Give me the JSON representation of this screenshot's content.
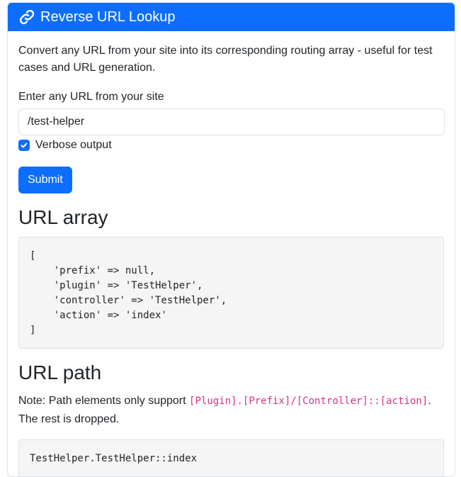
{
  "header": {
    "title": "Reverse URL Lookup",
    "icon": "link-icon"
  },
  "intro": "Convert any URL from your site into its corresponding routing array - useful for test cases and URL generation.",
  "form": {
    "url_label": "Enter any URL from your site",
    "url_value": "/test-helper",
    "verbose_label": "Verbose output",
    "verbose_checked": true,
    "submit_label": "Submit"
  },
  "url_array": {
    "heading": "URL array",
    "code": "[\n    'prefix' => null,\n    'plugin' => 'TestHelper',\n    'controller' => 'TestHelper',\n    'action' => 'index'\n]"
  },
  "url_path": {
    "heading": "URL path",
    "note_prefix": "Note: Path elements only support ",
    "note_code": "[Plugin].[Prefix]/[Controller]::[action]",
    "note_suffix": ". The rest is dropped.",
    "code": "TestHelper.TestHelper::index"
  },
  "colors": {
    "primary": "#0d6efd",
    "code_pink": "#d63384",
    "pre_bg": "#f5f5f5"
  }
}
